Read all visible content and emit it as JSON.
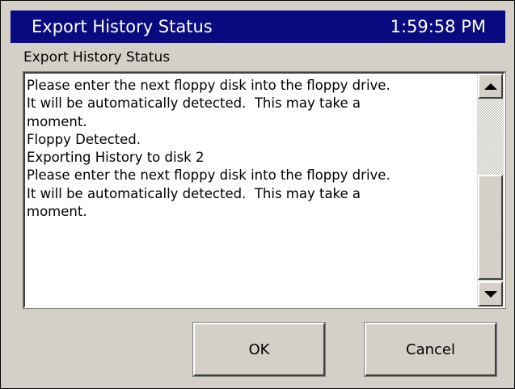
{
  "window": {
    "title": "Export History Status",
    "clock": "1:59:58 PM"
  },
  "dialog": {
    "subtitle": "Export History Status",
    "log_text": "Please enter the next floppy disk into the floppy drive.\nIt will be automatically detected.  This may take a\nmoment.\nFloppy Detected.\nExporting History to disk 2\nPlease enter the next floppy disk into the floppy drive.\nIt will be automatically detected.  This may take a\nmoment."
  },
  "buttons": {
    "ok_label": "OK",
    "cancel_label": "Cancel"
  },
  "colors": {
    "titlebar": "#0a0a80",
    "face": "#d4d0c8"
  },
  "icons": {
    "scroll_up": "triangle-up-icon",
    "scroll_down": "triangle-down-icon"
  }
}
